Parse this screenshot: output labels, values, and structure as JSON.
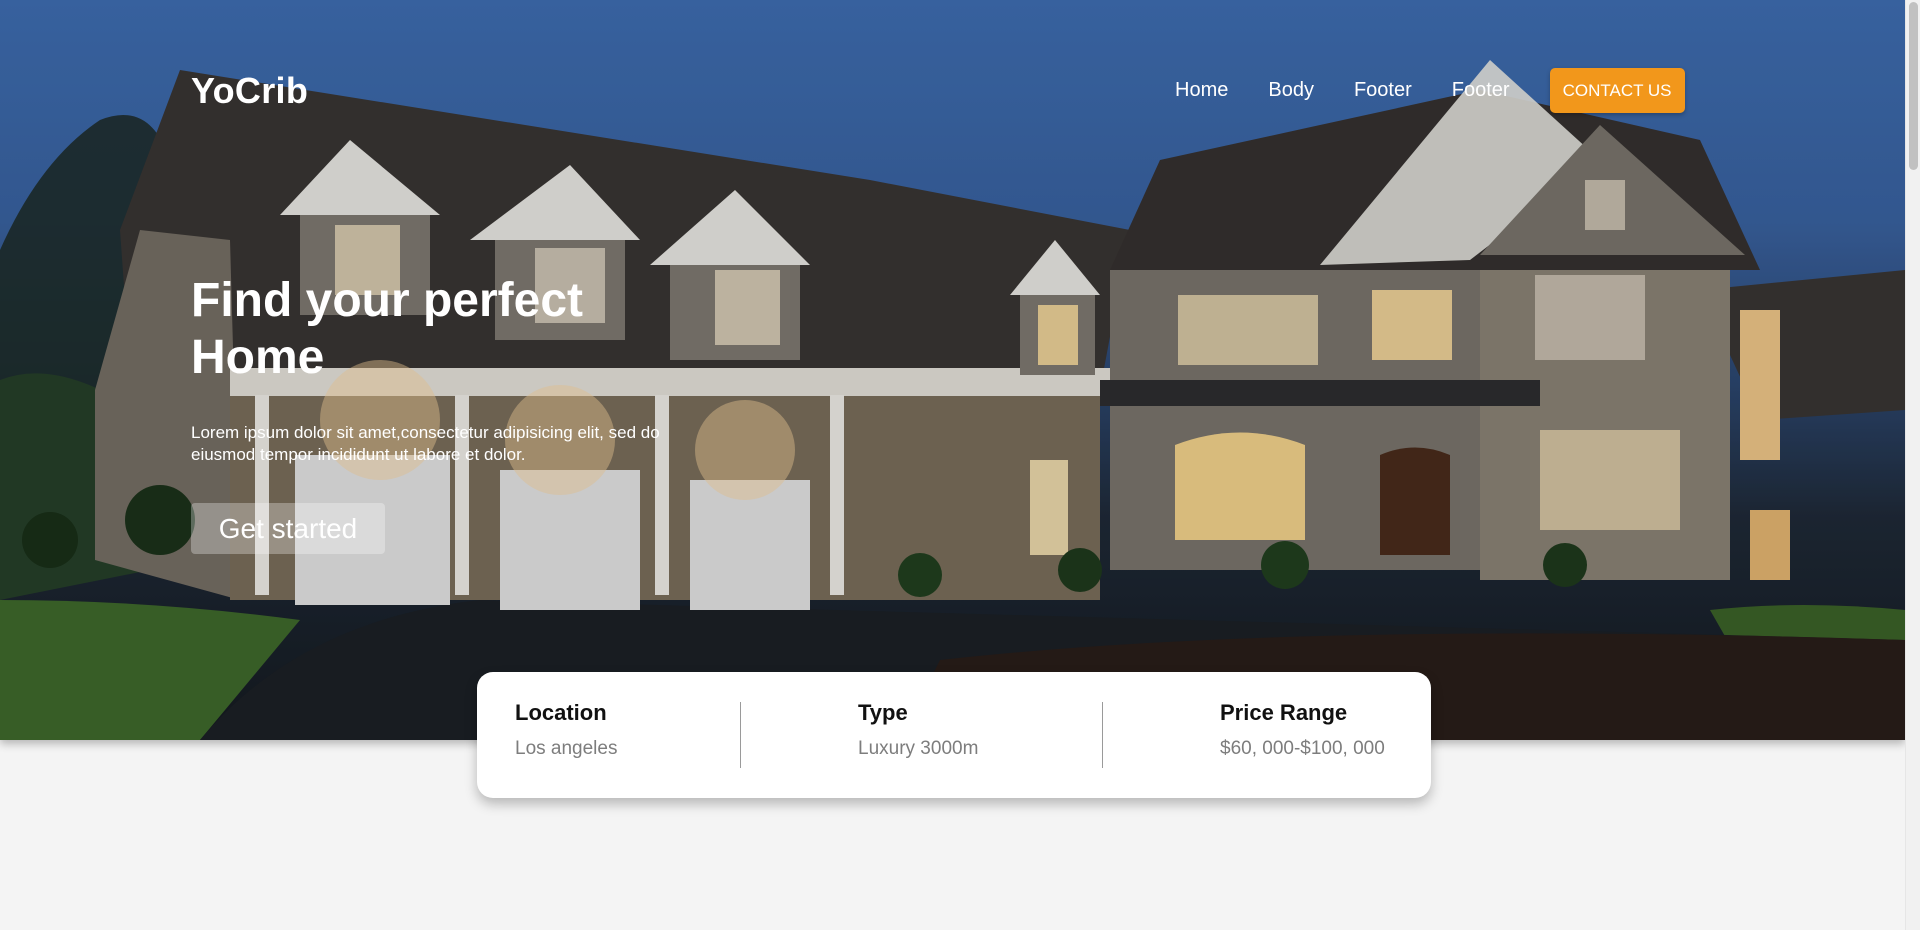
{
  "header": {
    "logo": "YoCrib",
    "nav": [
      "Home",
      "Body",
      "Footer",
      "Footer"
    ],
    "contact_label": "CONTACT US"
  },
  "hero": {
    "title": "Find your perfect Home",
    "description": "Lorem ipsum dolor sit amet,consectetur adipisicing elit, sed do eiusmod tempor incididunt ut labore et dolor.",
    "cta_label": "Get started"
  },
  "search": {
    "fields": [
      {
        "label": "Location",
        "value": "Los angeles"
      },
      {
        "label": "Type",
        "value": "Luxury 3000m"
      },
      {
        "label": "Price Range",
        "value": "$60, 000-$100, 000"
      }
    ]
  },
  "colors": {
    "accent": "#f2971b",
    "sky": "#3f6fb4",
    "card": "#ffffff"
  }
}
